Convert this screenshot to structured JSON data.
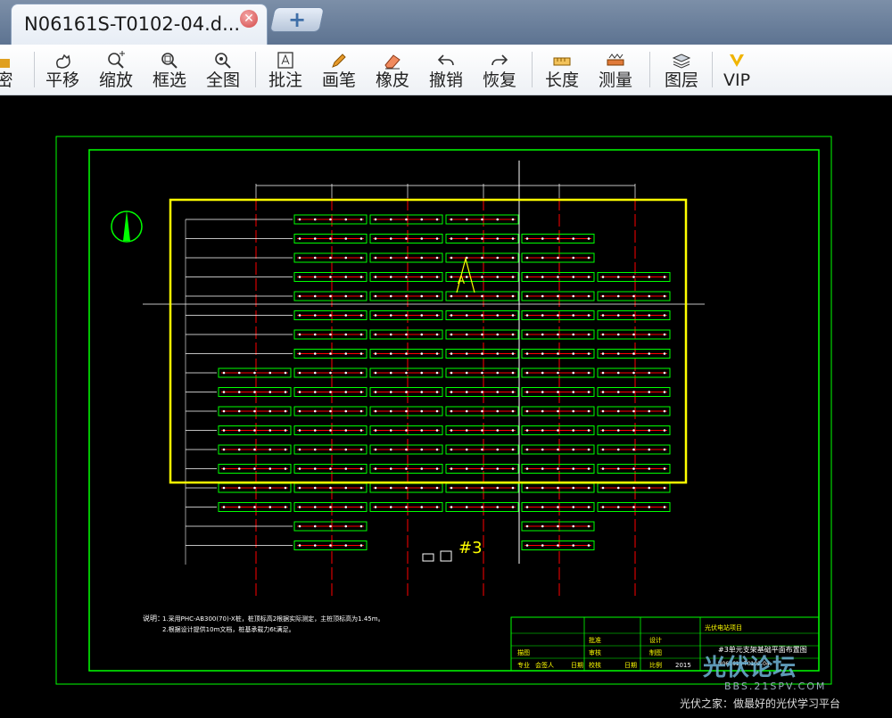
{
  "tab": {
    "title": "N06161S-T0102-04.d...",
    "close_symbol": "✕",
    "new_symbol": "+"
  },
  "toolbar": {
    "items": [
      {
        "id": "lock",
        "label": "密",
        "icon": "lock-icon"
      },
      {
        "id": "pan",
        "label": "平移",
        "icon": "pan-icon"
      },
      {
        "id": "zoom",
        "label": "缩放",
        "icon": "zoom-icon"
      },
      {
        "id": "box-select",
        "label": "框选",
        "icon": "box-select-icon"
      },
      {
        "id": "full-view",
        "label": "全图",
        "icon": "full-view-icon"
      },
      {
        "id": "annotate",
        "label": "批注",
        "icon": "annotate-icon"
      },
      {
        "id": "pen",
        "label": "画笔",
        "icon": "pen-icon"
      },
      {
        "id": "eraser",
        "label": "橡皮",
        "icon": "eraser-icon"
      },
      {
        "id": "undo",
        "label": "撤销",
        "icon": "undo-icon"
      },
      {
        "id": "redo",
        "label": "恢复",
        "icon": "redo-icon"
      },
      {
        "id": "length",
        "label": "长度",
        "icon": "length-icon"
      },
      {
        "id": "measure",
        "label": "测量",
        "icon": "measure-icon"
      },
      {
        "id": "layers",
        "label": "图层",
        "icon": "layers-icon"
      },
      {
        "id": "vip",
        "label": "VIP",
        "icon": "vip-icon"
      }
    ]
  },
  "drawing": {
    "area_label": "A",
    "unit_label": "#3",
    "notes_title": "说明：",
    "notes": [
      "1.采用PHC-AB300(70)-X桩，桩顶标高2根据实际测定，主桩顶标高为1.45m。",
      "2.根据设计提供10m文档，桩基承载力6t满足。"
    ],
    "title_block": {
      "project": "光伏电站项目",
      "drawing_title": "#3单元支架基础平面布置图",
      "drawing_number": "N06161S-T0102-04",
      "year": "2015",
      "labels": [
        "批准",
        "审核",
        "校核",
        "设计",
        "制图",
        "比例",
        "日期",
        "专业",
        "会签人",
        "日期",
        "描图"
      ]
    },
    "colors": {
      "frame": "#00ff00",
      "highlight": "#ffff00",
      "axis": "#ff0000",
      "lines": "#ffffff"
    }
  },
  "watermark": {
    "logo": "光伏论坛",
    "url": "BBS.21SPV.COM",
    "slogan": "光伏之家：做最好的光伏学习平台"
  }
}
